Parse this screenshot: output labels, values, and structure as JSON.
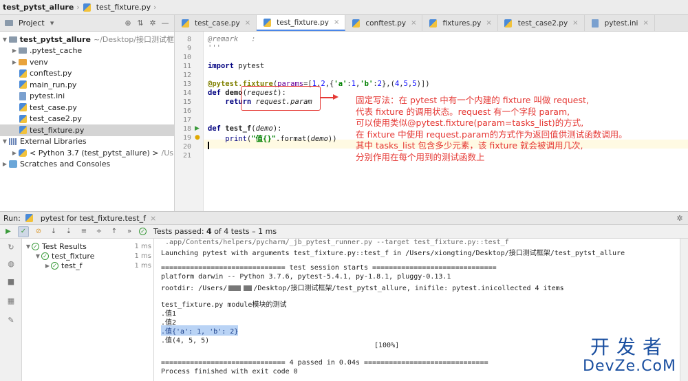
{
  "breadcrumb": {
    "project": "test_pytst_allure",
    "file": "test_fixture.py"
  },
  "project_panel": {
    "selector": "Project",
    "tree": [
      {
        "label": "test_pytst_allure",
        "extra": "~/Desktop/接口测试框",
        "kind": "folder",
        "expanded": true
      },
      {
        "label": ".pytest_cache",
        "kind": "folder"
      },
      {
        "label": "venv",
        "kind": "folder-orange"
      },
      {
        "label": "conftest.py",
        "kind": "py"
      },
      {
        "label": "main_run.py",
        "kind": "py"
      },
      {
        "label": "pytest.ini",
        "kind": "ini"
      },
      {
        "label": "test_case.py",
        "kind": "py"
      },
      {
        "label": "test_case2.py",
        "kind": "py"
      },
      {
        "label": "test_fixture.py",
        "kind": "py",
        "selected": true
      },
      {
        "label": "External Libraries",
        "kind": "libs"
      },
      {
        "label": "< Python 3.7 (test_pytst_allure) >",
        "extra": "/Us",
        "kind": "python"
      },
      {
        "label": "Scratches and Consoles",
        "kind": "scratch"
      }
    ]
  },
  "editor_tabs": [
    {
      "label": "test_case.py"
    },
    {
      "label": "test_fixture.py",
      "active": true
    },
    {
      "label": "conftest.py"
    },
    {
      "label": "fixtures.py"
    },
    {
      "label": "test_case2.py"
    },
    {
      "label": "pytest.ini"
    }
  ],
  "code": {
    "line_numbers": [
      "8",
      "9",
      "10",
      "11",
      "12",
      "13",
      "14",
      "15",
      "16",
      "17",
      "18",
      "19",
      "20",
      "21"
    ],
    "l8": "@remark   :",
    "l9": "'''",
    "l11_kw": "import",
    "l11_rest": " pytest",
    "l13_dec": "@pytest.fixture",
    "l13_open": "(",
    "l13_param": "params",
    "l13_eq": "=[",
    "l13_n1": "1",
    "l13_c1": ",",
    "l13_n2": "2",
    "l13_c2": ",{",
    "l13_s1": "'a'",
    "l13_c3": ":",
    "l13_n3": "1",
    "l13_c4": ",",
    "l13_s2": "'b'",
    "l13_c5": ":",
    "l13_n4": "2",
    "l13_c6": "},(",
    "l13_n5": "4",
    "l13_c7": ",",
    "l13_n6": "5",
    "l13_c8": ",",
    "l13_n7": "5",
    "l13_c9": ")])",
    "l14_kw": "def",
    "l14_fn": " demo",
    "l14_open": "(",
    "l14_arg": "request",
    "l14_close": "):",
    "l15_kw": "return",
    "l15_rest": " request.param",
    "l18_kw": "def",
    "l18_fn": " test_f",
    "l18_open": "(",
    "l18_arg": "demo",
    "l18_close": "):",
    "l19_fn": "print",
    "l19_open": "(",
    "l19_str": "\"值{}\"",
    "l19_mid": ".format(",
    "l19_arg": "demo",
    "l19_close": "))"
  },
  "annotation": [
    "固定写法：在 pytest 中有一个内建的 fixture 叫做 request,",
    "代表 fixture 的调用状态。request 有一个字段 param,",
    "可以使用类似@pytest.fixture(param=tasks_list)的方式,",
    "在 fixture 中使用 request.param的方式作为返回值供测试函数调用。",
    "其中 tasks_list 包含多少元素，该 fixture 就会被调用几次,",
    "分别作用在每个用到的测试函数上"
  ],
  "run": {
    "label": "Run:",
    "config": "pytest for test_fixture.test_f",
    "status_prefix": "Tests passed:",
    "status_count": "4",
    "status_suffix": "of 4 tests – 1 ms",
    "tree": [
      {
        "label": "Test Results",
        "dur": "1 ms"
      },
      {
        "label": "test_fixture",
        "dur": "1 ms"
      },
      {
        "label": "test_f",
        "dur": "1 ms"
      }
    ],
    "console": {
      "l0": " .app/Contents/helpers/pycharm/_jb_pytest_runner.py --target test_fixture.py::test_f",
      "l1": "Launching pytest with arguments test_fixture.py::test_f in /Users/xiongting/Desktop/接口测试框架/test_pytst_allure",
      "l2": "============================== test session starts ==============================",
      "l3": "platform darwin -- Python 3.7.6, pytest-5.4.1, py-1.8.1, pluggy-0.13.1",
      "l4a": "rootdir: /Users/",
      "l4b": "/Desktop/接口测试框架/test_pytst_allure, inifile: pytest.inicollected 4 items",
      "l5": "test_fixture.py module模块的测试",
      "l6": ".值1",
      "l7": ".值2",
      "l8": ".值{'a': 1, 'b': 2}",
      "l9": ".值(4, 5, 5)",
      "l10": "[100%]",
      "l11": "============================== 4 passed in 0.04s ==============================",
      "l12": "Process finished with exit code 0"
    }
  },
  "watermark": {
    "cn": "开发者",
    "en": "DevZe.CoM"
  },
  "colors": {
    "accent": "#4a86e8",
    "annotation_red": "#e53935",
    "pass_green": "#3a9a3a",
    "watermark_blue": "#1a4fa0"
  }
}
